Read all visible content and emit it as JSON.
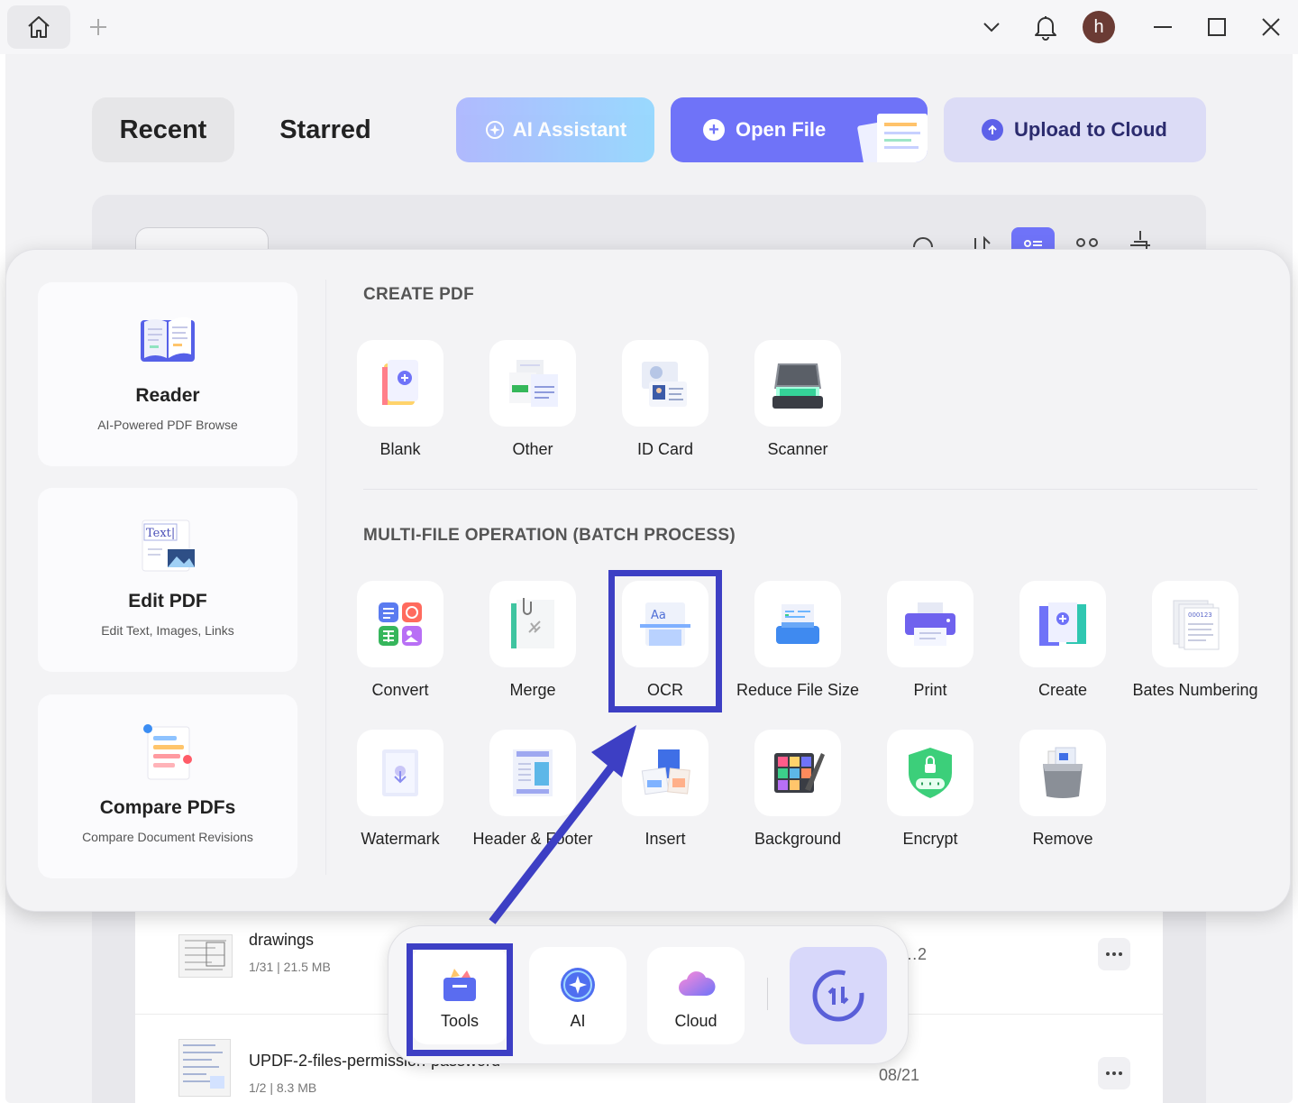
{
  "titlebar": {
    "avatar_letter": "h",
    "icons": [
      "home-icon",
      "plus-icon",
      "chevron-down-icon",
      "bell-icon",
      "minimize-icon",
      "maximize-icon",
      "close-icon"
    ]
  },
  "tabs": {
    "recent": "Recent",
    "starred": "Starred"
  },
  "actions": {
    "ai_assistant": "AI Assistant",
    "open_file": "Open File",
    "upload_to_cloud": "Upload to Cloud"
  },
  "files": [
    {
      "name": "drawings",
      "meta": "1/31 | 21.5 MB",
      "date": "…2"
    },
    {
      "name": "UPDF-2-files-permission-password",
      "meta": "1/2 | 8.3 MB",
      "date": "08/21"
    }
  ],
  "tools_panel": {
    "cards": [
      {
        "title": "Reader",
        "subtitle": "AI-Powered PDF Browse"
      },
      {
        "title": "Edit PDF",
        "subtitle": "Edit Text, Images, Links"
      },
      {
        "title": "Compare PDFs",
        "subtitle": "Compare Document Revisions"
      }
    ],
    "create_section_title": "CREATE PDF",
    "create_items": [
      "Blank",
      "Other",
      "ID Card",
      "Scanner"
    ],
    "batch_section_title": "MULTI-FILE OPERATION (BATCH PROCESS)",
    "batch_row1": [
      "Convert",
      "Merge",
      "OCR",
      "Reduce File Size",
      "Print",
      "Create",
      "Bates Numbering"
    ],
    "batch_row2": [
      "Watermark",
      "Header & Footer",
      "Insert",
      "Background",
      "Encrypt",
      "Remove"
    ],
    "edit_icon_text": "Text|"
  },
  "dock": {
    "tools": "Tools",
    "ai": "AI",
    "cloud": "Cloud"
  },
  "colors": {
    "accent": "#6f73f8",
    "highlight": "#3d3fc4",
    "panel": "#f3f3f5"
  }
}
